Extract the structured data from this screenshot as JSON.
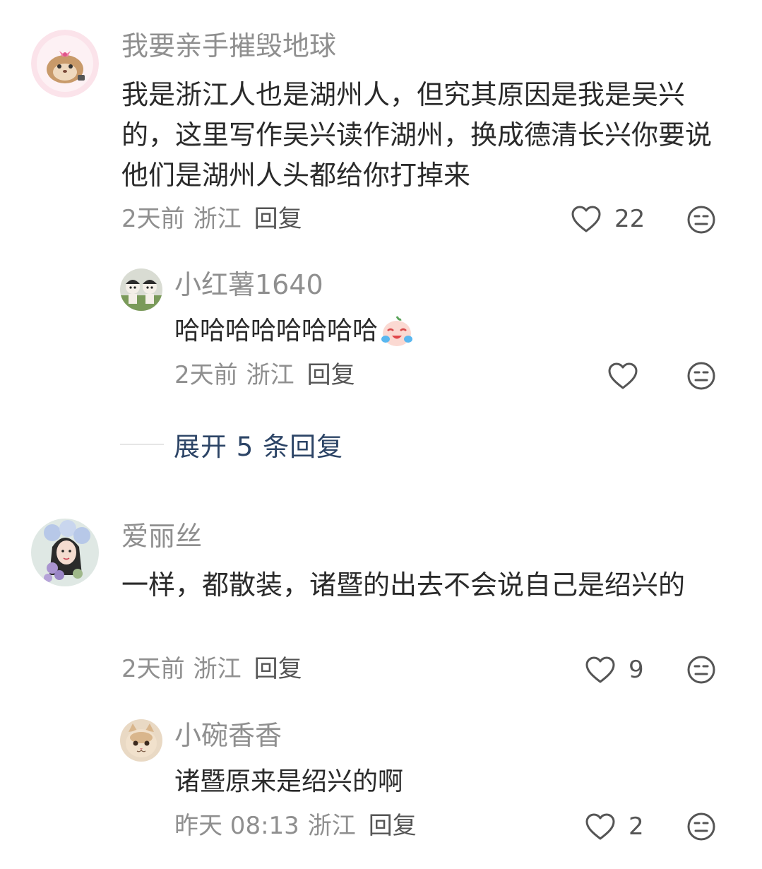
{
  "comments": [
    {
      "author": "我要亲手摧毁地球",
      "text": "我是浙江人也是湖州人，但究其原因是我是吴兴的，这里写作吴兴读作湖州，换成德清长兴你要说他们是湖州人头都给你打掉来",
      "time": "2天前",
      "location": "浙江",
      "reply_label": "回复",
      "likes": "22",
      "avatar_icon": "hamster-avatar",
      "replies": [
        {
          "author": "小红薯1640",
          "text": "哈哈哈哈哈哈哈哈",
          "emoji": "crying-laughing-emoji",
          "time": "2天前",
          "location": "浙江",
          "reply_label": "回复",
          "likes": "",
          "avatar_icon": "figurines-avatar"
        }
      ],
      "expand_label": "展开 5 条回复"
    },
    {
      "author": "爱丽丝",
      "text": "一样，都散装，诸暨的出去不会说自己是绍兴的",
      "time": "2天前",
      "location": "浙江",
      "reply_label": "回复",
      "likes": "9",
      "avatar_icon": "girl-flowers-avatar",
      "replies": [
        {
          "author": "小碗香香",
          "text": "诸暨原来是绍兴的啊",
          "time": "昨天 08:13",
          "location": "浙江",
          "reply_label": "回复",
          "likes": "2",
          "avatar_icon": "cat-avatar"
        }
      ]
    }
  ],
  "colors": {
    "author": "#8f8f8f",
    "text": "#2a2a2a",
    "meta": "#8f8f8f",
    "expand": "#2c4466",
    "icon": "#555555"
  }
}
